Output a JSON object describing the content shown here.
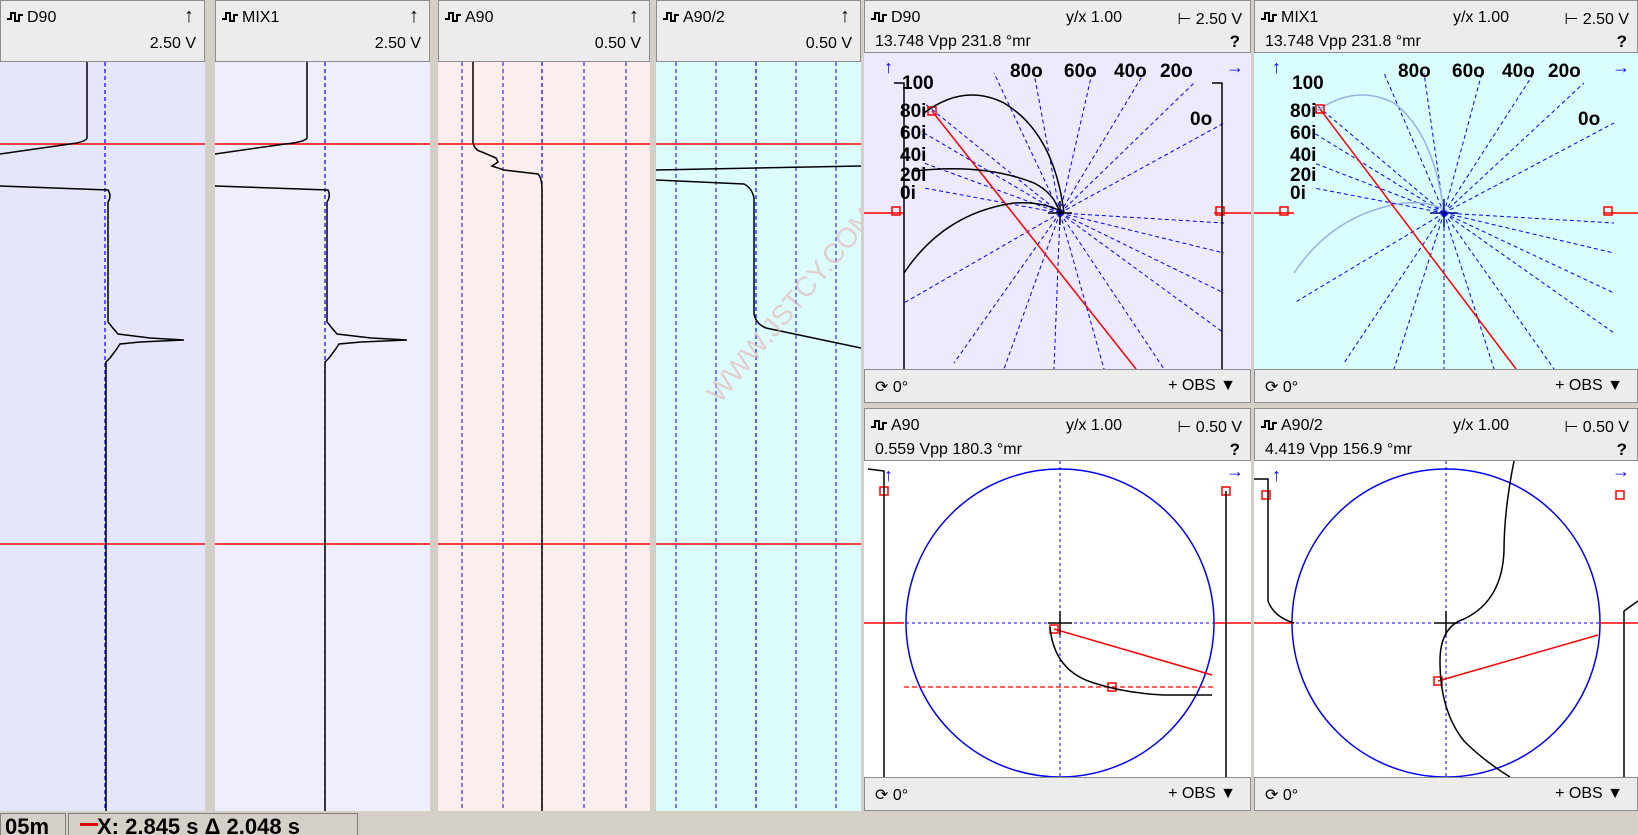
{
  "strips": [
    {
      "name": "D90",
      "voltage": "2.50 V",
      "bg": "#e6e6fb"
    },
    {
      "name": "MIX1",
      "voltage": "2.50 V",
      "bg": "#efeefc"
    },
    {
      "name": "A90",
      "voltage": "0.50 V",
      "bg": "#fdeeee"
    },
    {
      "name": "A90/2",
      "voltage": "0.50 V",
      "bg": "#dcfcfc"
    }
  ],
  "xy_panels": [
    {
      "name": "D90",
      "ratio": "1.00",
      "scale": "2.50 V",
      "reading": "13.748 Vpp 231.8 °mr",
      "rotation": "0°",
      "obs": "+ OBS ▼",
      "bg": "#eceafc"
    },
    {
      "name": "MIX1",
      "ratio": "1.00",
      "scale": "2.50 V",
      "reading": "13.748 Vpp 231.8 °mr",
      "rotation": "0°",
      "obs": "+ OBS ▼",
      "bg": "#dafdfd"
    },
    {
      "name": "A90",
      "ratio": "1.00",
      "scale": "0.50 V",
      "reading": "0.559 Vpp 180.3 °mr",
      "rotation": "0°",
      "obs": "+ OBS ▼",
      "bg": "#ffffff"
    },
    {
      "name": "A90/2",
      "ratio": "1.00",
      "scale": "0.50 V",
      "reading": "4.419 Vpp 156.9 °mr",
      "rotation": "0°",
      "obs": "+ OBS ▼",
      "bg": "#ffffff"
    }
  ],
  "grid_labels": {
    "top": [
      "80o",
      "60o",
      "40o",
      "20o"
    ],
    "left": [
      "100",
      "80i",
      "60i",
      "40i",
      "20i",
      "0i"
    ],
    "right": "0o"
  },
  "status": {
    "length": "05m",
    "cursor": "X: 2.845 s Δ 2.048 s"
  },
  "colors": {
    "trace": "#000000",
    "cursor": "#ff0000",
    "grid": "#0000ff"
  }
}
